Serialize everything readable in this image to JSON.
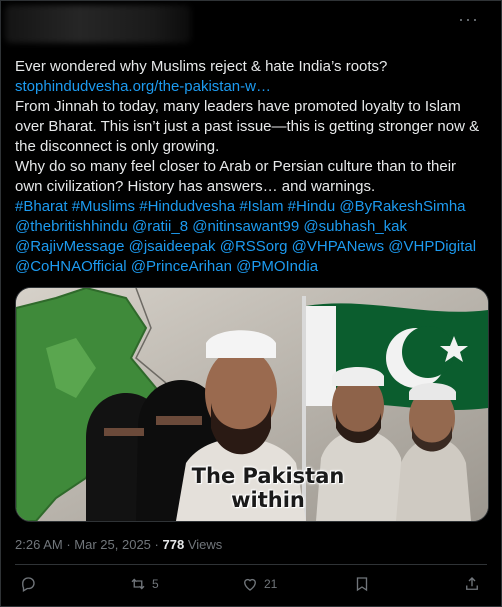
{
  "tweet": {
    "line1": "Ever wondered why Muslims reject & hate India’s roots?",
    "link": "stophindudvesha.org/the-pakistan-w…",
    "para1": "From Jinnah to today, many leaders have promoted loyalty to Islam over Bharat. This isn’t just a past issue—this is getting stronger now & the disconnect is only growing.",
    "para2": "Why do so many feel closer to Arab or Persian culture than to their own civilization? History has answers… and warnings.",
    "tags": [
      "#Bharat",
      "#Muslims",
      "#Hindudvesha",
      "#Islam",
      "#Hindu",
      "@ByRakeshSimha",
      "@thebritishhindu",
      "@ratii_8",
      "@nitinsawant99",
      "@subhash_kak",
      "@RajivMessage",
      "@jsaideepak",
      "@RSSorg",
      "@VHPANews",
      "@VHPDigital",
      "@CoHNAOfficial",
      "@PrinceArihan",
      "@PMOIndia"
    ]
  },
  "media": {
    "caption_line1": "The Pakistan",
    "caption_line2": "within",
    "colors": {
      "flag_green": "#0b5d2e",
      "map_green": "#3f8a3a"
    }
  },
  "meta": {
    "time": "2:26 AM",
    "separator": "·",
    "date": "Mar 25, 2025",
    "separator2": "·",
    "views_count": "778",
    "views_label": "Views"
  },
  "actions": {
    "reply_icon": "reply-icon",
    "retweet_count": "5",
    "like_count": "21",
    "bookmark_icon": "bookmark-icon",
    "share_icon": "share-icon"
  },
  "more_label": "···"
}
